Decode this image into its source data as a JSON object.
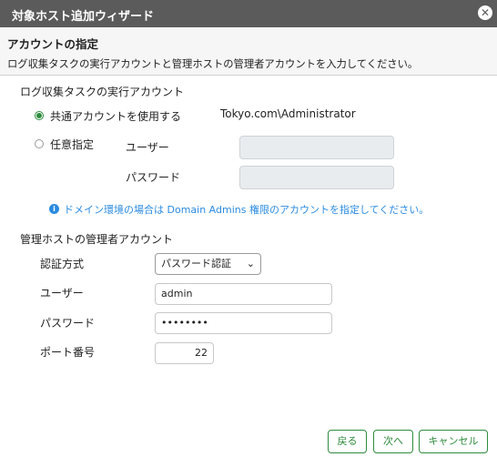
{
  "dialog": {
    "title": "対象ホスト追加ウィザード",
    "close_symbol": "✕"
  },
  "header": {
    "title": "アカウントの指定",
    "description": "ログ収集タスクの実行アカウントと管理ホストの管理者アカウントを入力してください。"
  },
  "exec_account": {
    "section_label": "ログ収集タスクの実行アカウント",
    "option_shared_label": "共通アカウントを使用する",
    "shared_account_value": "Tokyo.com\\Administrator",
    "option_custom_label": "任意指定",
    "user_label": "ユーザー",
    "password_label": "パスワード",
    "selected_option": "shared",
    "info_text": "ドメイン環境の場合は Domain Admins 権限のアカウントを指定してください。"
  },
  "admin_account": {
    "section_label": "管理ホストの管理者アカウント",
    "auth_label": "認証方式",
    "auth_value": "パスワード認証",
    "user_label": "ユーザー",
    "user_value": "admin",
    "password_label": "パスワード",
    "password_value": "••••••••",
    "port_label": "ポート番号",
    "port_value": "22"
  },
  "buttons": {
    "back": "戻る",
    "next": "次へ",
    "cancel": "キャンセル"
  },
  "colors": {
    "titlebar": "#5b5b5b",
    "accent_green": "#2e8b3e",
    "info_blue": "#2b8be0",
    "disabled_field": "#e9ecef"
  },
  "icons": {
    "close": "close-icon",
    "info": "info-icon",
    "dropdown": "chevron-down-icon"
  }
}
